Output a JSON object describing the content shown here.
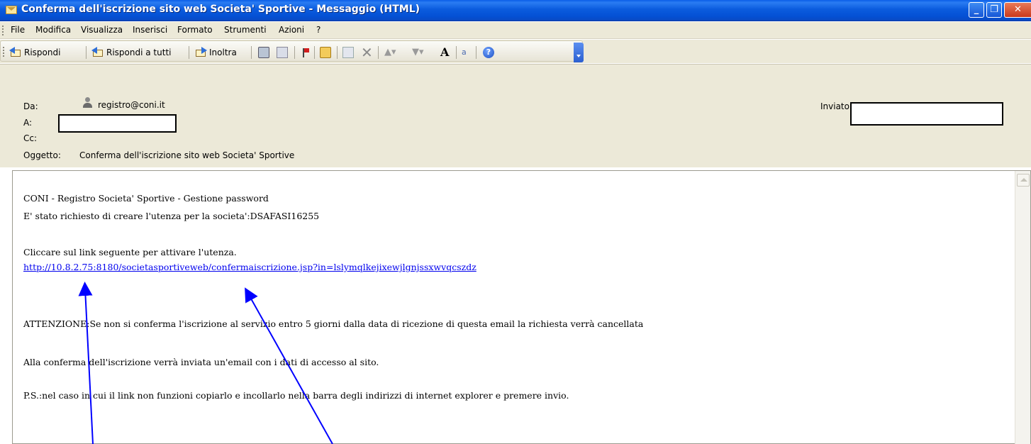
{
  "window": {
    "title": "Conferma dell'iscrizione sito web Societa' Sportive - Messaggio (HTML)",
    "controls": {
      "minimize": "_",
      "maximize": "❐",
      "close": "✕"
    }
  },
  "menu": [
    "File",
    "Modifica",
    "Visualizza",
    "Inserisci",
    "Formato",
    "Strumenti",
    "Azioni",
    "?"
  ],
  "toolbar": {
    "reply": "Rispondi",
    "reply_all": "Rispondi a tutti",
    "forward": "Inoltra",
    "font_size_glyph": "A",
    "translate_glyph": "a",
    "help_glyph": "?"
  },
  "header": {
    "from_label": "Da:",
    "from_value": "registro@coni.it",
    "to_label": "A:",
    "cc_label": "Cc:",
    "subject_label": "Oggetto:",
    "subject_value": "Conferma dell'iscrizione sito web Societa' Sportive",
    "sent_label": "Inviato:"
  },
  "body": {
    "line1": "CONI - Registro Societa' Sportive - Gestione password",
    "line2": "E' stato richiesto di creare l'utenza per la societa':DSAFASI16255",
    "line3": "Cliccare sul link seguente per attivare l'utenza.",
    "link": "http://10.8.2.75:8180/societasportiveweb/confermaiscrizione.jsp?in=lslymqlkejixewjlgnjssxwvqcszdz",
    "warning": "ATTENZIONE:Se non si conferma l'iscrizione al servizio entro 5 giorni dalla data di ricezione di questa email la richiesta verrà cancellata",
    "line5": "Alla conferma dell'iscrizione verrà inviata un'email con i dati di accesso al sito.",
    "line6": "P.S.:nel caso in cui il link non funzioni copiarlo e incollarlo nella barra degli indirizzi di internet explorer e premere invio."
  },
  "colors": {
    "titlebar": "#0b5cde",
    "chrome": "#ece9d8",
    "link": "#0000ee",
    "annotation_arrow": "#0000ff"
  }
}
